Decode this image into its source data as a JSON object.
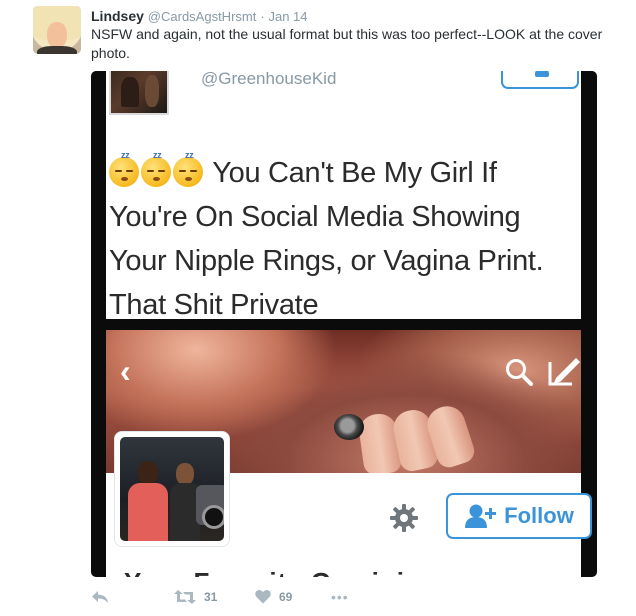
{
  "tweet": {
    "name": "Lindsey",
    "handle": "@CardsAgstHrsmt",
    "separator": "·",
    "date": "Jan 14",
    "text": "NSFW and again, not the usual format but this was too perfect--LOOK at the cover photo."
  },
  "media": {
    "top_handle": "@GreenhouseKid",
    "quote": "You Can't Be My Girl If You're On Social Media Showing Your Nipple Rings, or Vagina Print. That Shit Private",
    "emoji_zz": "zz",
    "follow_label": "Follow",
    "profile_name": "Your Favorite Gemini"
  },
  "actions": {
    "retweet_count": "31",
    "like_count": "69",
    "more_label": "•••"
  },
  "colors": {
    "name": "#292f33",
    "muted": "#8899a6",
    "follow_blue": "#3b94d9",
    "media_bg": "#0b0b0b"
  },
  "icons": [
    "reply-icon",
    "retweet-icon",
    "heart-icon",
    "more-icon",
    "back-icon",
    "search-icon",
    "edit-icon",
    "gear-icon",
    "add-user-icon"
  ]
}
